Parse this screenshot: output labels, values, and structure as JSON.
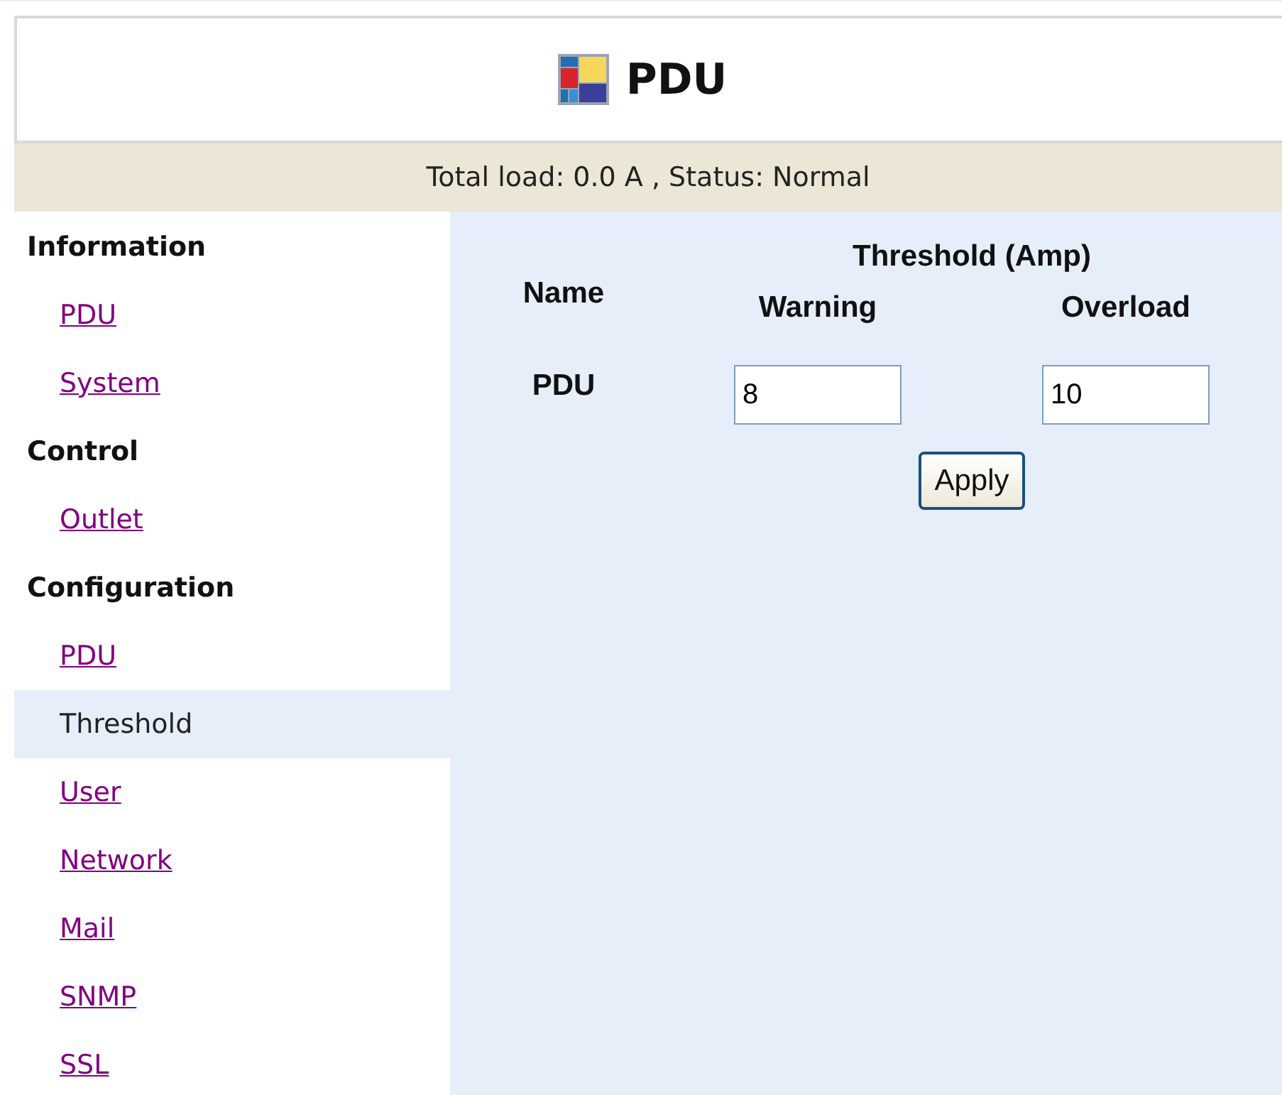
{
  "header": {
    "title": "PDU"
  },
  "status_bar": "Total load: 0.0 A , Status: Normal",
  "sidebar": {
    "sections": [
      {
        "heading": "Information",
        "items": [
          {
            "label": "PDU",
            "selected": false
          },
          {
            "label": "System",
            "selected": false
          }
        ]
      },
      {
        "heading": "Control",
        "items": [
          {
            "label": "Outlet",
            "selected": false
          }
        ]
      },
      {
        "heading": "Configuration",
        "items": [
          {
            "label": "PDU",
            "selected": false
          },
          {
            "label": "Threshold",
            "selected": true
          },
          {
            "label": "User",
            "selected": false
          },
          {
            "label": "Network",
            "selected": false
          },
          {
            "label": "Mail",
            "selected": false
          },
          {
            "label": "SNMP",
            "selected": false
          },
          {
            "label": "SSL",
            "selected": false
          }
        ]
      }
    ]
  },
  "form": {
    "name_heading": "Name",
    "group_heading": "Threshold (Amp)",
    "warning_heading": "Warning",
    "overload_heading": "Overload",
    "rows": [
      {
        "name": "PDU",
        "warning": "8",
        "overload": "10"
      }
    ],
    "button": "Apply"
  }
}
